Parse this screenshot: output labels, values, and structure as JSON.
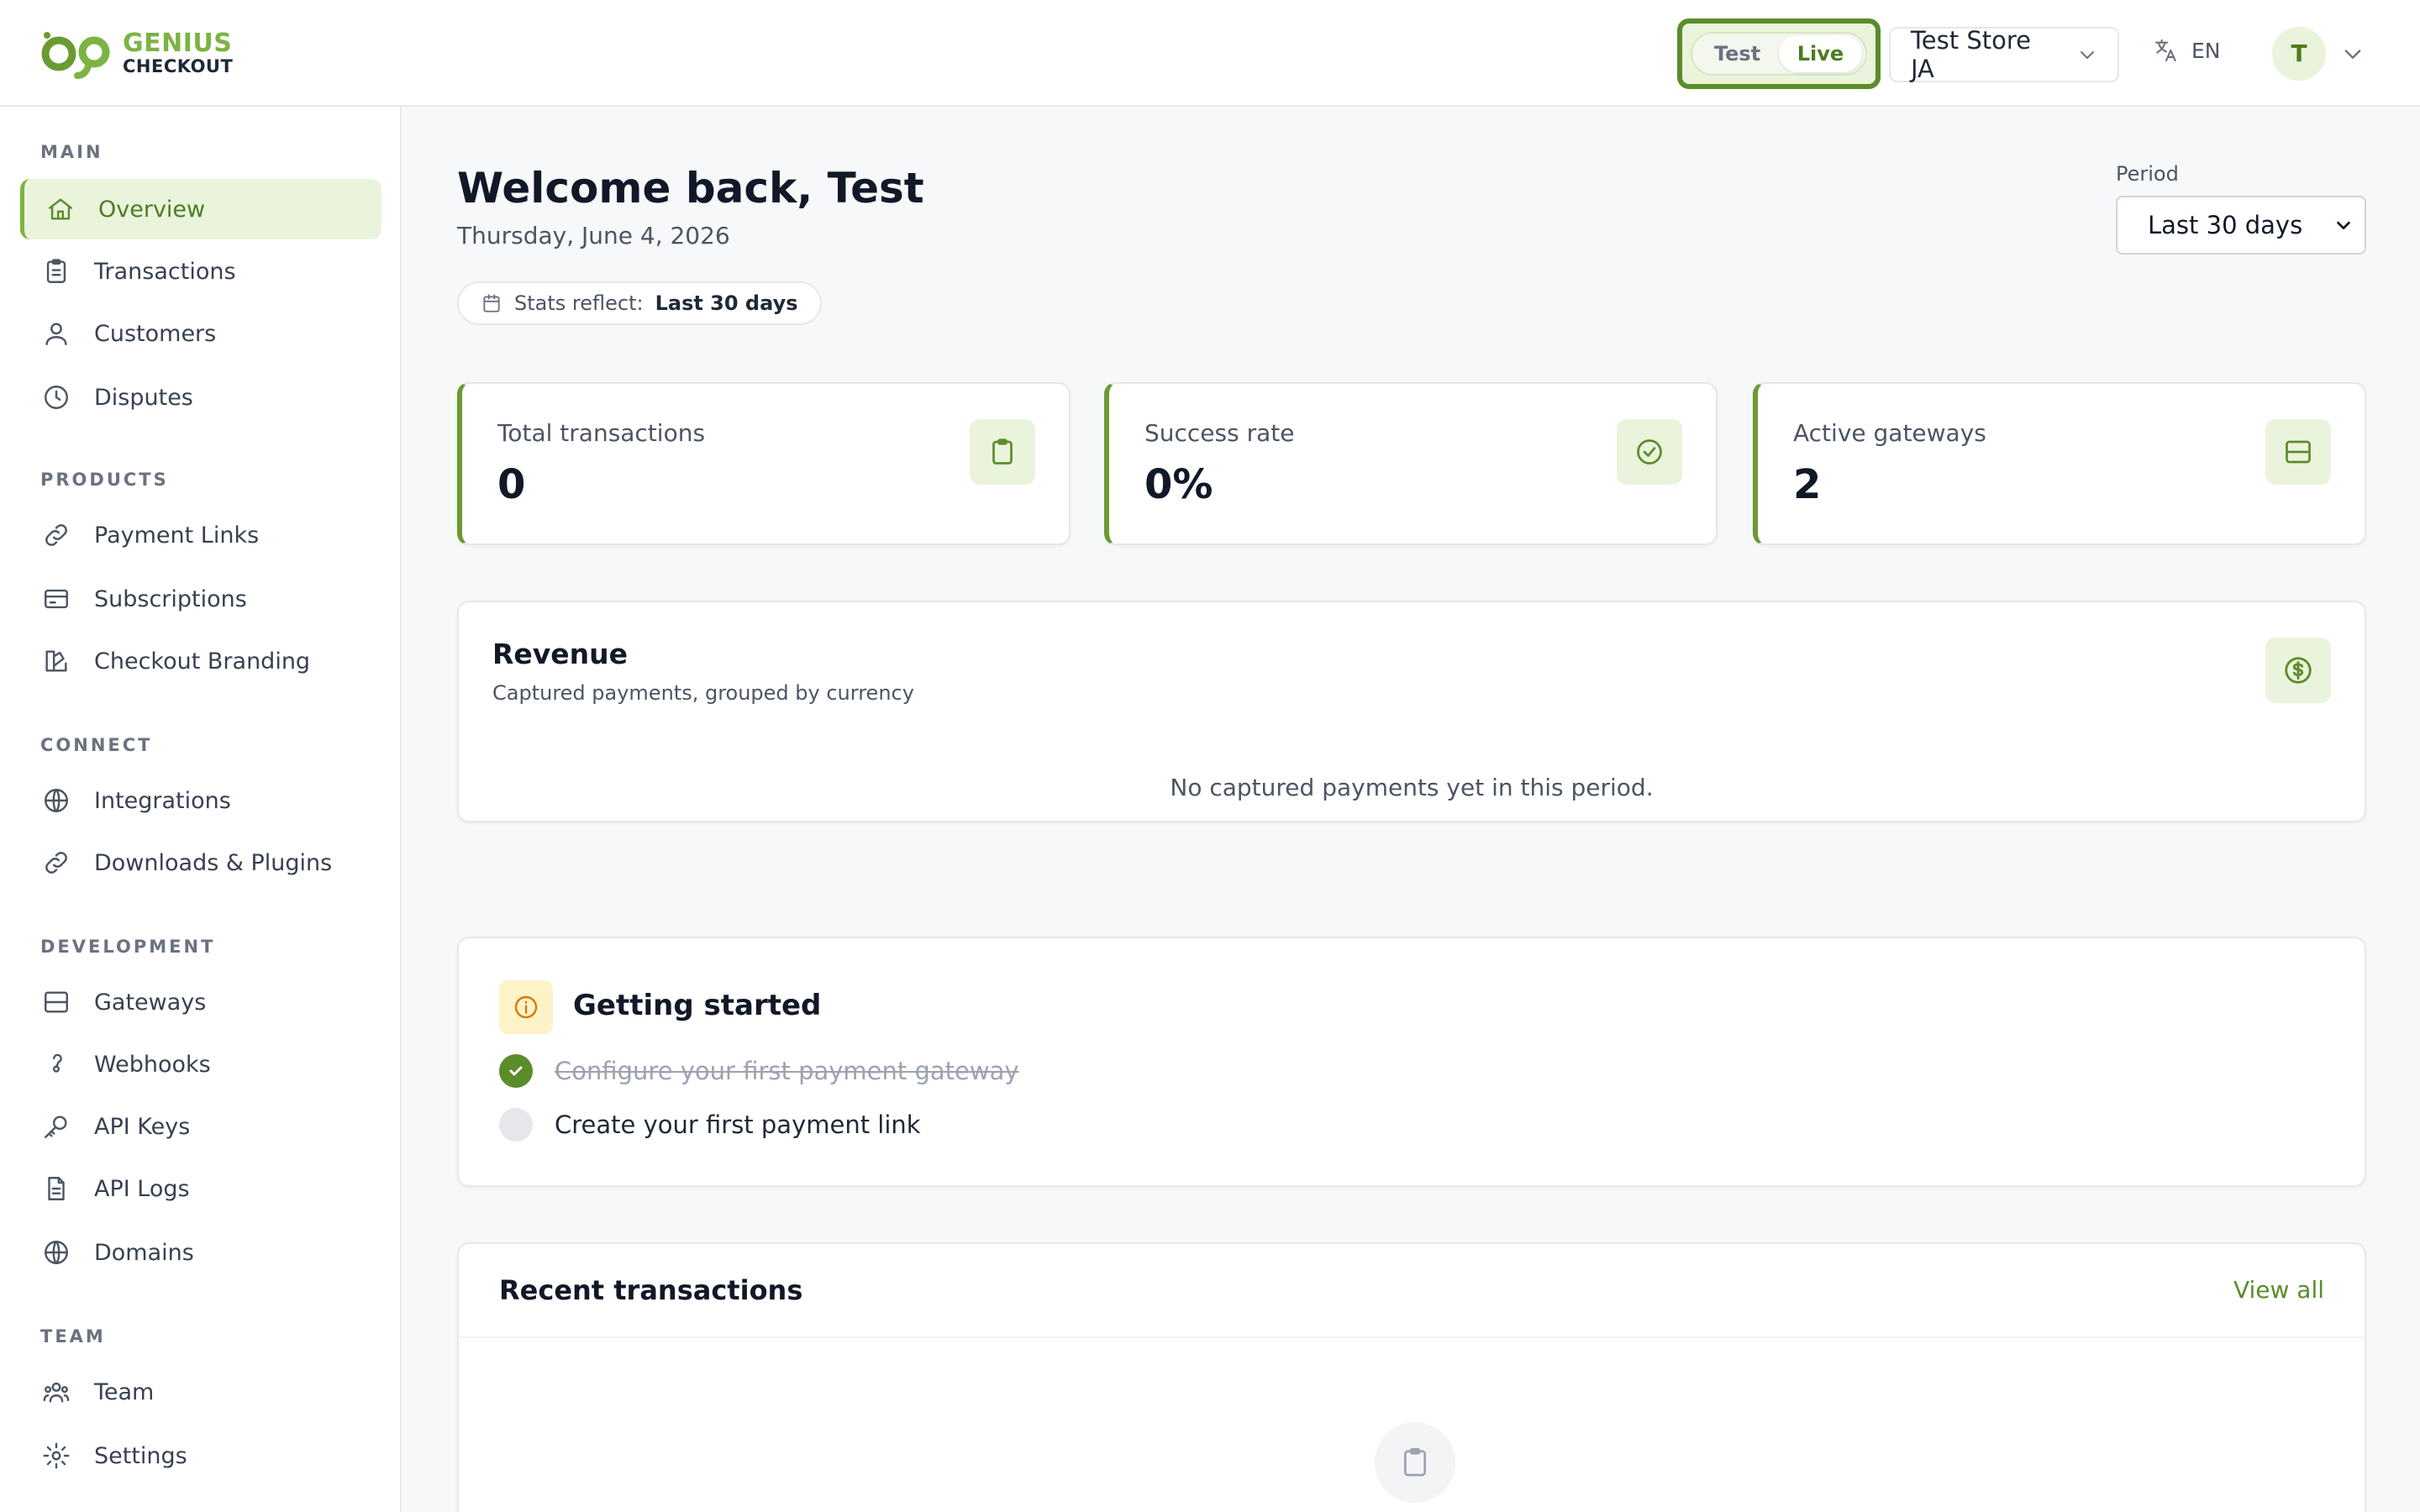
{
  "brand": {
    "name_line1": "GENIUS",
    "name_line2": "CHECKOUT",
    "accent_color": "#7cb342",
    "dark_accent": "#4d7c1f"
  },
  "header": {
    "mode_toggle": {
      "options": [
        "Test",
        "Live"
      ],
      "selected": "Live"
    },
    "store_selector": {
      "label": "Test Store JA",
      "icon": "chevron-down-icon"
    },
    "language": {
      "label": "EN",
      "icon": "translate-icon"
    },
    "user": {
      "avatar_initial": "T",
      "icon": "chevron-down-icon"
    }
  },
  "sidebar": {
    "sections": [
      {
        "label": "MAIN",
        "items": [
          {
            "label": "Overview",
            "icon": "home-icon",
            "active": true
          },
          {
            "label": "Transactions",
            "icon": "clipboard-icon"
          },
          {
            "label": "Customers",
            "icon": "users-icon"
          },
          {
            "label": "Disputes",
            "icon": "clock-icon"
          }
        ]
      },
      {
        "label": "PRODUCTS",
        "items": [
          {
            "label": "Payment Links",
            "icon": "link-icon"
          },
          {
            "label": "Subscriptions",
            "icon": "card-icon"
          },
          {
            "label": "Checkout Branding",
            "icon": "palette-icon"
          }
        ]
      },
      {
        "label": "CONNECT",
        "items": [
          {
            "label": "Integrations",
            "icon": "globe-icon"
          },
          {
            "label": "Downloads & Plugins",
            "icon": "link-icon"
          }
        ]
      },
      {
        "label": "DEVELOPMENT",
        "items": [
          {
            "label": "Gateways",
            "icon": "server-icon"
          },
          {
            "label": "Webhooks",
            "icon": "webhook-icon"
          },
          {
            "label": "API Keys",
            "icon": "key-icon"
          },
          {
            "label": "API Logs",
            "icon": "file-icon"
          },
          {
            "label": "Domains",
            "icon": "globe-icon"
          }
        ]
      },
      {
        "label": "TEAM",
        "items": [
          {
            "label": "Team",
            "icon": "team-icon"
          },
          {
            "label": "Settings",
            "icon": "gear-icon"
          }
        ]
      }
    ]
  },
  "main": {
    "welcome": "Welcome back, Test",
    "date": "Thursday, June 4, 2026",
    "stats_pill": {
      "prefix": "Stats reflect:",
      "value": "Last 30 days",
      "icon": "calendar-icon"
    },
    "period": {
      "label": "Period",
      "selected": "Last 30 days"
    },
    "stat_cards": [
      {
        "label": "Total transactions",
        "value": "0",
        "icon": "clipboard-icon"
      },
      {
        "label": "Success rate",
        "value": "0%",
        "icon": "check-circle-icon"
      },
      {
        "label": "Active gateways",
        "value": "2",
        "icon": "server-icon"
      }
    ],
    "revenue": {
      "title": "Revenue",
      "subtitle": "Captured payments, grouped by currency",
      "empty": "No captured payments yet in this period.",
      "icon": "dollar-icon"
    },
    "getting_started": {
      "title": "Getting started",
      "icon": "info-icon",
      "steps": [
        {
          "label": "Configure your first payment gateway",
          "done": true
        },
        {
          "label": "Create your first payment link",
          "done": false
        }
      ]
    },
    "recent_transactions": {
      "title": "Recent transactions",
      "view_all": "View all",
      "empty_icon": "clipboard-icon"
    }
  }
}
